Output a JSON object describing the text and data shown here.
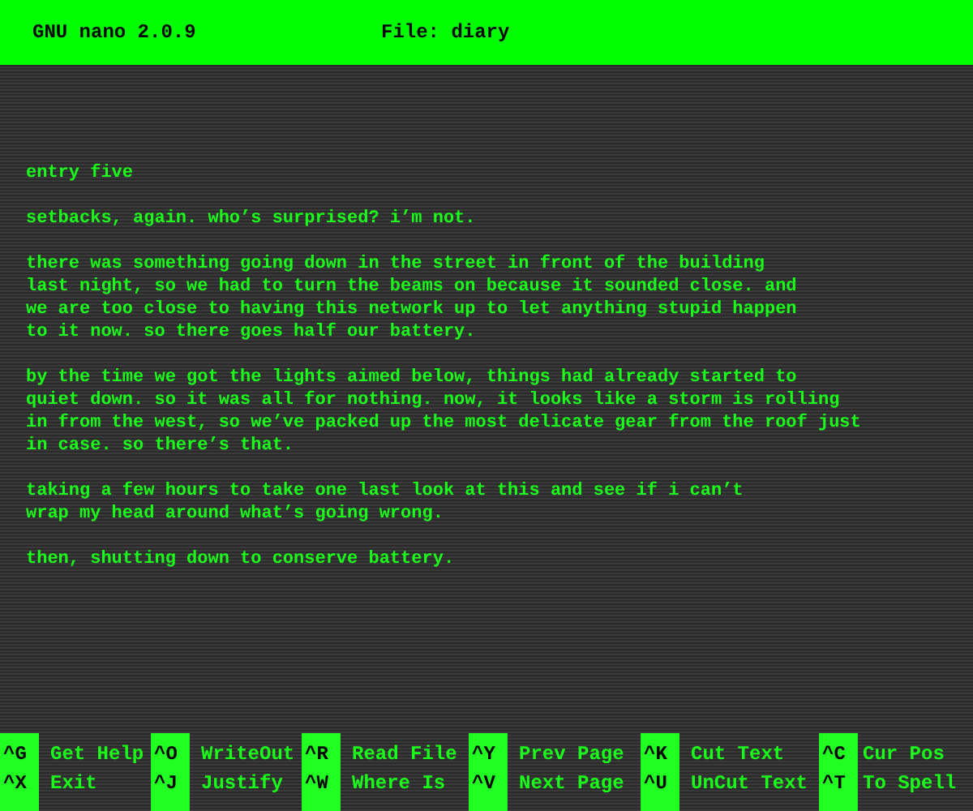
{
  "title_bar": {
    "app": "GNU nano 2.0.9",
    "file": "File: diary"
  },
  "paragraphs": [
    [
      "entry five"
    ],
    [
      "setbacks, again. who’s surprised? i’m not."
    ],
    [
      "there was something going down in the street in front of the building",
      "last night, so we had to turn the beams on because it sounded close. and",
      "we are too close to having this network up to let anything stupid happen",
      "to it now. so there goes half our battery."
    ],
    [
      "by the time we got the lights aimed below, things had already started to",
      "quiet down. so it was all for nothing. now, it looks like a storm is rolling",
      "in from the west, so we’ve packed up the most delicate gear from the roof just",
      "in case. so there’s that."
    ],
    [
      "taking a few hours to take one last look at this and see if i can’t",
      "wrap my head around what’s going wrong."
    ],
    [
      "then, shutting down to conserve battery."
    ]
  ],
  "shortcuts": [
    [
      {
        "key": "^G",
        "label": "Get Help"
      },
      {
        "key": "^X",
        "label": "Exit"
      }
    ],
    [
      {
        "key": "^O",
        "label": "WriteOut"
      },
      {
        "key": "^J",
        "label": "Justify"
      }
    ],
    [
      {
        "key": "^R",
        "label": "Read File"
      },
      {
        "key": "^W",
        "label": "Where Is"
      }
    ],
    [
      {
        "key": "^Y",
        "label": "Prev Page"
      },
      {
        "key": "^V",
        "label": "Next Page"
      }
    ],
    [
      {
        "key": "^K",
        "label": "Cut Text"
      },
      {
        "key": "^U",
        "label": "UnCut Text"
      }
    ],
    [
      {
        "key": "^C",
        "label": "Cur Pos"
      },
      {
        "key": "^T",
        "label": "To Spell"
      }
    ]
  ]
}
